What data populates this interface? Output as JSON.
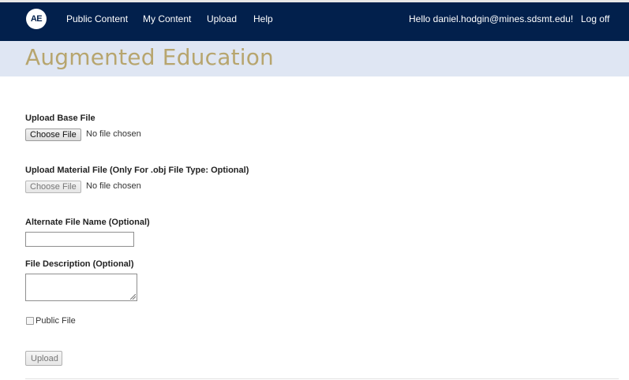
{
  "navbar": {
    "logo_text": "AE",
    "links": [
      {
        "label": "Public Content"
      },
      {
        "label": "My Content"
      },
      {
        "label": "Upload"
      },
      {
        "label": "Help"
      }
    ],
    "greeting": "Hello daniel.hodgin@mines.sdsmt.edu!",
    "logoff": "Log off",
    "bg_color": "#02204c"
  },
  "header": {
    "title": "Augmented Education",
    "title_color": "#b7a56e",
    "band_color": "#dfe6f3"
  },
  "form": {
    "base_file": {
      "label": "Upload Base File",
      "button": "Choose File",
      "status": "No file chosen"
    },
    "material_file": {
      "label": "Upload Material File (Only For .obj File Type: Optional)",
      "button": "Choose File",
      "status": "No file chosen"
    },
    "alt_name": {
      "label": "Alternate File Name (Optional)",
      "value": ""
    },
    "description": {
      "label": "File Description (Optional)",
      "value": ""
    },
    "public_file": {
      "label": "Public File",
      "checked": false
    },
    "submit_label": "Upload"
  }
}
